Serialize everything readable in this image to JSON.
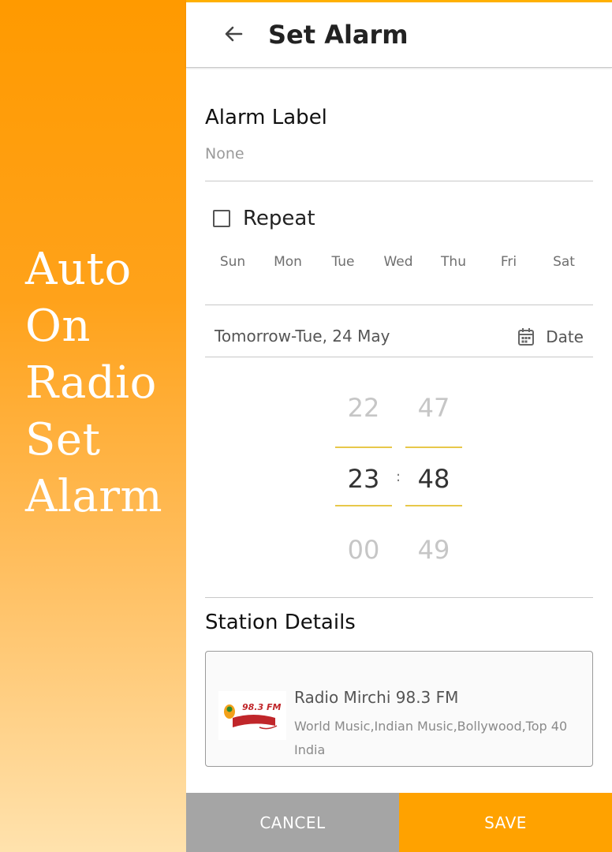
{
  "promo": {
    "lines": [
      "Auto",
      "On",
      "Radio",
      "Set",
      "Alarm"
    ]
  },
  "header": {
    "title": "Set Alarm",
    "back_icon": "arrow-left-icon"
  },
  "alarm_label": {
    "heading": "Alarm Label",
    "value": "None"
  },
  "repeat": {
    "label": "Repeat",
    "checked": false,
    "days": [
      "Sun",
      "Mon",
      "Tue",
      "Wed",
      "Thu",
      "Fri",
      "Sat"
    ]
  },
  "date": {
    "text": "Tomorrow-Tue, 24 May",
    "button_label": "Date",
    "icon": "calendar-icon"
  },
  "time_picker": {
    "hours": {
      "prev": "22",
      "selected": "23",
      "next": "00"
    },
    "minutes": {
      "prev": "47",
      "selected": "48",
      "next": "49"
    },
    "separator": ":"
  },
  "station": {
    "heading": "Station Details",
    "name": "Radio Mirchi 98.3 FM",
    "genres": "World Music,Indian Music,Bollywood,Top 40",
    "country": "India",
    "logo_text": "98.3 FM"
  },
  "actions": {
    "cancel_label": "CANCEL",
    "save_label": "SAVE"
  },
  "colors": {
    "accent": "#ffa200",
    "cancel": "#a5a5a5",
    "picker_line": "#e8c84a"
  }
}
